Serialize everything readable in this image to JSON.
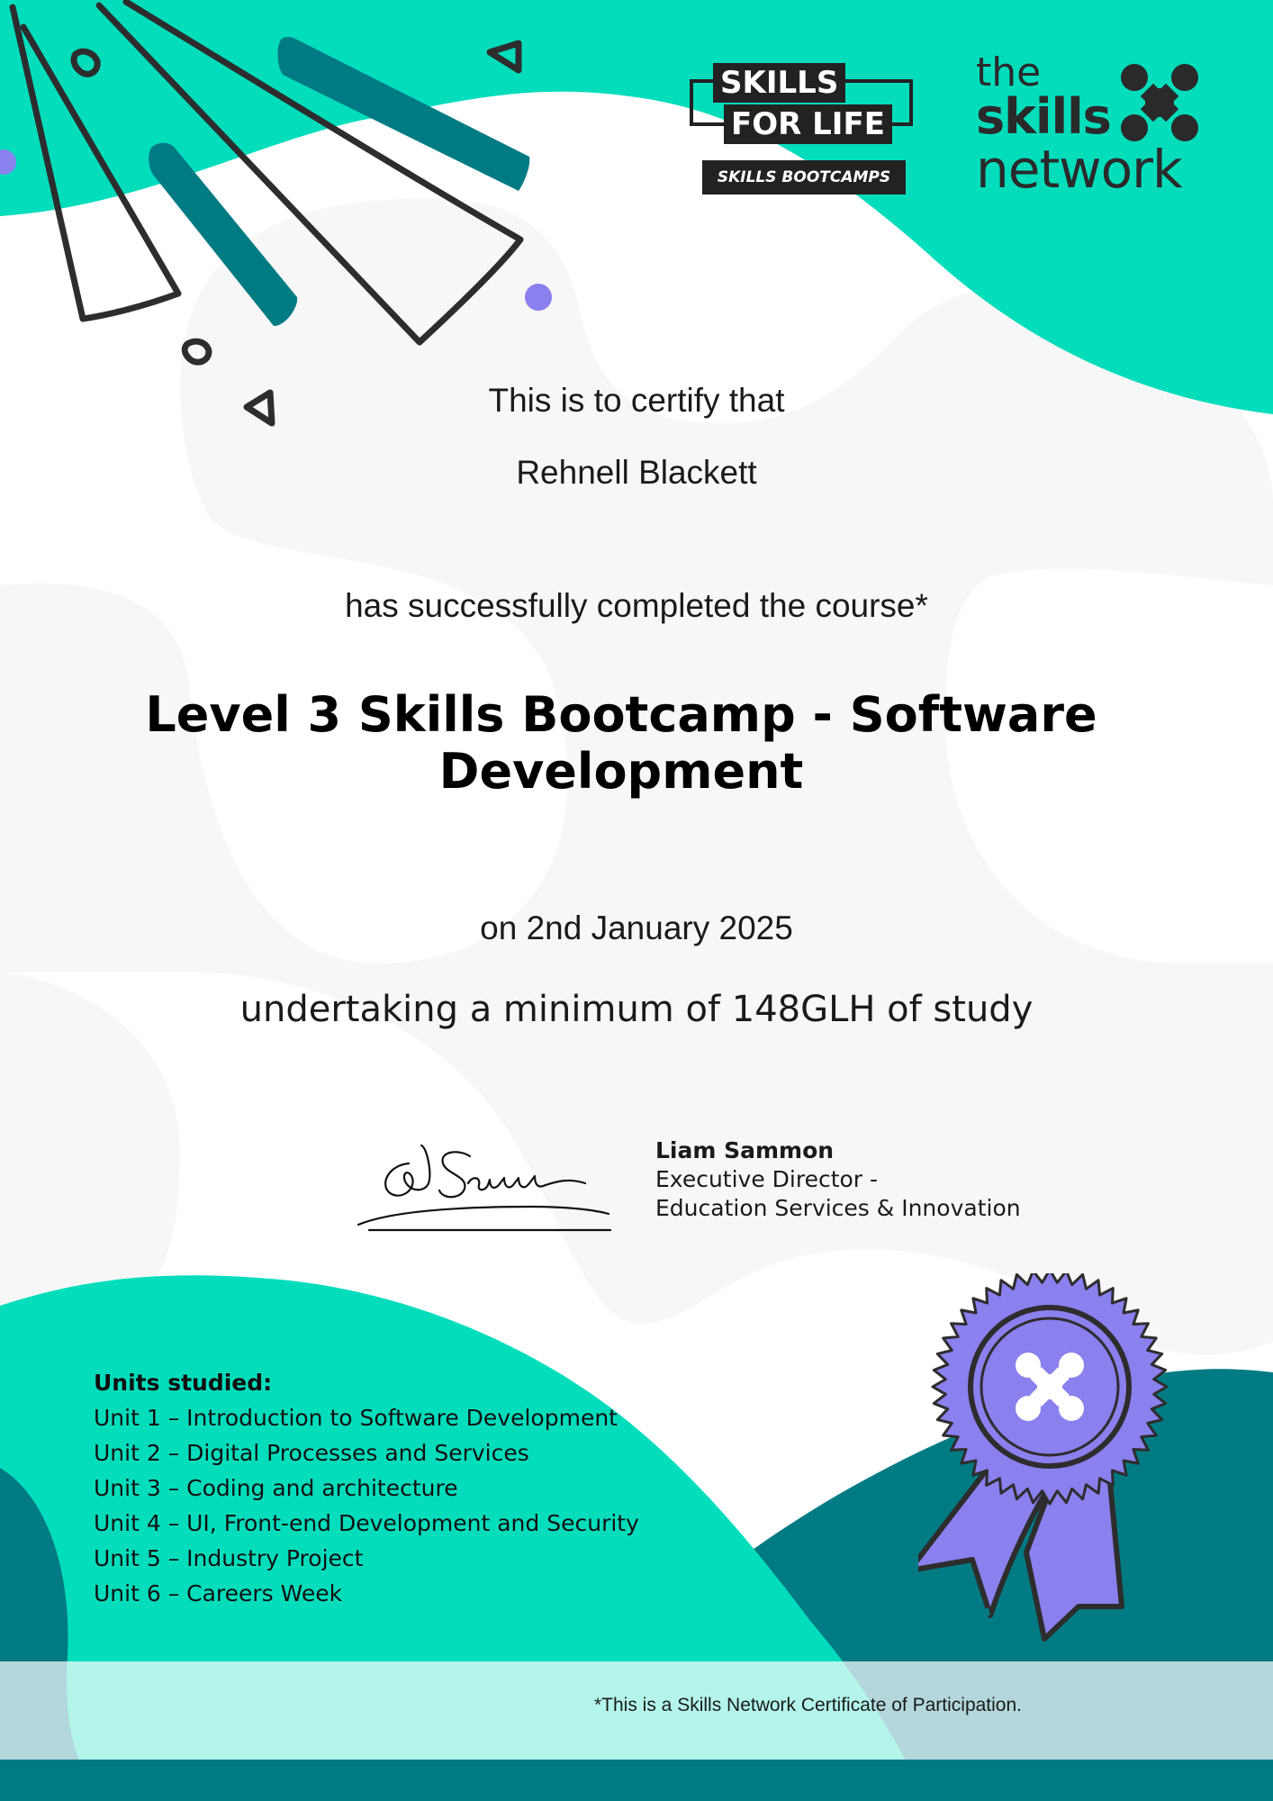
{
  "colors": {
    "teal": "#03DDBC",
    "dark_teal": "#007B84",
    "purple": "#8A80EE",
    "light_grey": "#F7F7F7",
    "ink": "#2D2D2D"
  },
  "logos": {
    "skills_for_life": {
      "line1": "SKILLS",
      "line2": "FOR LIFE",
      "line3": "SKILLS BOOTCAMPS"
    },
    "skills_network": {
      "line1": "the",
      "line2": "skills",
      "line3": "network",
      "icon": "network-node-icon"
    }
  },
  "certificate": {
    "intro": "This is to certify that",
    "recipient": "Rehnell Blackett",
    "completed": "has successfully completed the course*",
    "course": "Level 3 Skills Bootcamp - Software Development",
    "date": "on 2nd January 2025",
    "hours": "undertaking a minimum of 148GLH of study"
  },
  "signatory": {
    "name": "Liam Sammon",
    "title_line1": "Executive Director -",
    "title_line2": "Education Services & Innovation",
    "signature_image": "handwritten-signature"
  },
  "units": {
    "heading": "Units studied:",
    "items": [
      "Unit 1 – Introduction to Software Development",
      "Unit 2 – Digital Processes and Services",
      "Unit 3 – Coding and architecture",
      "Unit 4 – UI, Front-end Development and Security",
      "Unit 5 – Industry Project",
      "Unit 6 – Careers Week"
    ]
  },
  "badge": {
    "icon": "rosette-award-icon"
  },
  "footnote": "*This is a Skills Network Certificate of Participation."
}
